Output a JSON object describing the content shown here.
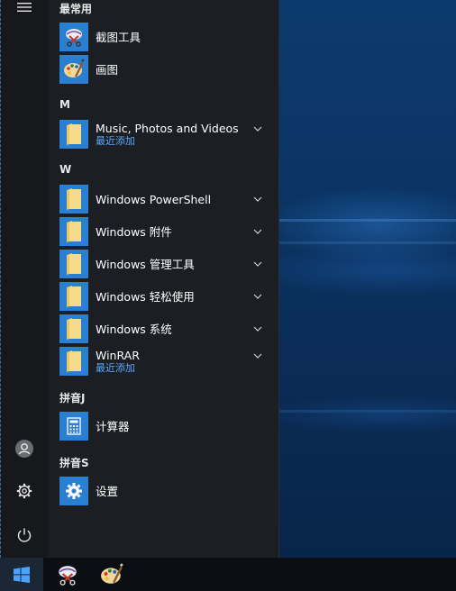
{
  "groups": {
    "frequent": "最常用",
    "m": "M",
    "w": "W",
    "pinyin_j": "拼音J",
    "pinyin_s": "拼音S"
  },
  "apps": {
    "snipping_tool": "截图工具",
    "paint": "画图",
    "music_photos_videos": "Music, Photos and Videos",
    "music_photos_videos_sub": "最近添加",
    "powershell": "Windows PowerShell",
    "accessories": "Windows 附件",
    "admin_tools": "Windows 管理工具",
    "ease_of_access": "Windows 轻松使用",
    "system": "Windows 系统",
    "winrar": "WinRAR",
    "winrar_sub": "最近添加",
    "calculator": "计算器",
    "settings": "设置"
  },
  "colors": {
    "tile_blue": "#2a7fd0",
    "folder_yellow": "#f6dc8a",
    "recent_blue": "#5aa9ff"
  },
  "icons": {
    "rail": [
      "hamburger-menu-icon",
      "user-icon",
      "gear-icon",
      "power-icon"
    ],
    "taskbar": [
      "windows-logo-icon",
      "snipping-tool-icon",
      "paint-icon"
    ]
  }
}
